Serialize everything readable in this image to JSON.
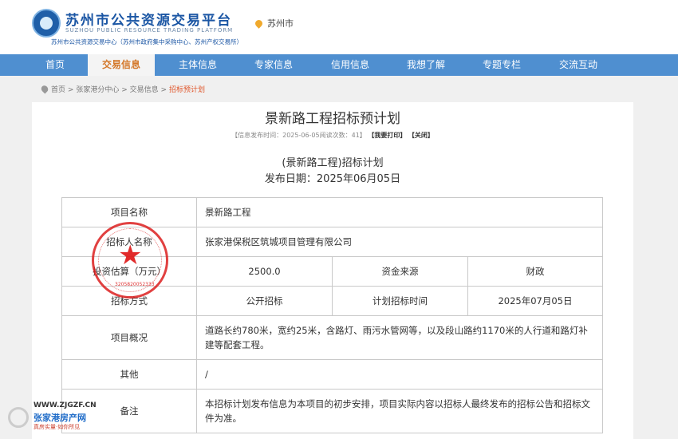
{
  "header": {
    "title": "苏州市公共资源交易平台",
    "title_en": "SUZHOU PUBLIC RESOURCE TRADING PLATFORM",
    "subtitle": "苏州市公共资源交易中心（苏州市政府集中采购中心、苏州产权交易所）",
    "location": "苏州市",
    "location_icon": "location-pin-icon",
    "brand_color": "#1b56a4"
  },
  "nav": {
    "items": [
      {
        "label": "首页"
      },
      {
        "label": "交易信息",
        "active": true
      },
      {
        "label": "主体信息"
      },
      {
        "label": "专家信息"
      },
      {
        "label": "信用信息"
      },
      {
        "label": "我想了解"
      },
      {
        "label": "专题专栏"
      },
      {
        "label": "交流互动"
      }
    ],
    "bar_color": "#4f8fd0",
    "active_color": "#d4782a"
  },
  "breadcrumb": {
    "items": [
      "首页",
      "张家港分中心",
      "交易信息",
      "招标预计划"
    ],
    "separator": ">"
  },
  "article": {
    "title": "景新路工程招标预计划",
    "meta": {
      "publish": "【信息发布时间：2025-06-05阅读次数：41】",
      "print_label": "【我要打印】",
      "close_label": "【关闭】"
    },
    "sub_title": "(景新路工程)招标计划",
    "date_line": "发布日期：2025年06月05日",
    "table": {
      "project_name_label": "项目名称",
      "project_name": "景新路工程",
      "tenderer_label": "招标人名称",
      "tenderer": "张家港保税区筑城项目管理有限公司",
      "budget_label": "投资估算（万元）",
      "budget": "2500.0",
      "fund_label": "资金来源",
      "fund": "财政",
      "method_label": "招标方式",
      "method": "公开招标",
      "plan_time_label": "计划招标时间",
      "plan_time": "2025年07月05日",
      "overview_label": "项目概况",
      "overview": "道路长约780米，宽约25米，含路灯、雨污水管网等，以及段山路约1170米的人行道和路灯补建等配套工程。",
      "other_label": "其他",
      "other": "/",
      "remark_label": "备注",
      "remark": "本招标计划发布信息为本项目的初步安排，项目实际内容以招标人最终发布的招标公告和招标文件为准。"
    }
  },
  "seal": {
    "text": "张家港保税区筑城项目管理有限公司",
    "number": "3205820052333",
    "color": "#dc1e1e"
  },
  "watermark": {
    "url": "WWW.ZJGZF.CN",
    "name": "张家港房产网",
    "slogan": "真房实量·如你所见"
  }
}
